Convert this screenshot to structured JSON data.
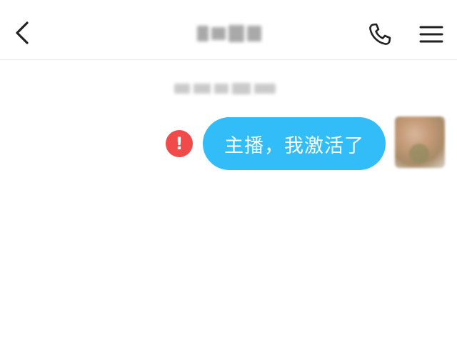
{
  "header": {
    "back_icon": "chevron-left-icon",
    "contact_name": "",
    "call_icon": "phone-icon",
    "menu_icon": "hamburger-menu-icon"
  },
  "conversation": {
    "timestamp": "",
    "messages": [
      {
        "direction": "outgoing",
        "text": "主播，我激活了",
        "status": "failed",
        "status_icon": "error-exclamation-icon",
        "status_glyph": "!",
        "bubble_color": "#33bdf8"
      }
    ]
  },
  "colors": {
    "bubble": "#33bdf8",
    "error": "#f04a4a",
    "icon": "#222222",
    "divider": "#ececec"
  }
}
